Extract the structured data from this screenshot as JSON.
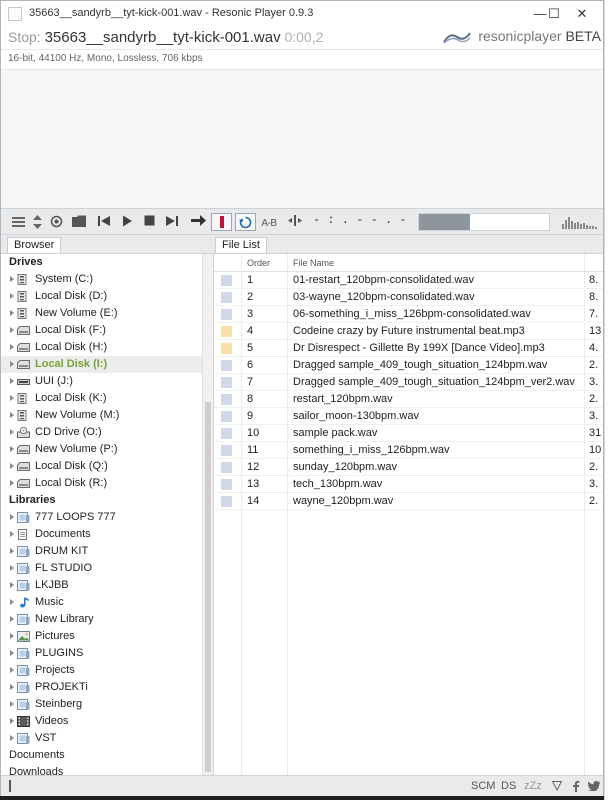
{
  "window": {
    "title": "35663__sandyrb__tyt-kick-001.wav - Resonic Player 0.9.3",
    "minimize": "—",
    "maximize": "☐",
    "close": "✕"
  },
  "player": {
    "status": "Stop:",
    "filename": "35663__sandyrb__tyt-kick-001.wav",
    "time": "0:00,2",
    "brand": "resonicplayer",
    "beta": "BETA",
    "fileinfo": "16-bit, 44100 Hz, Mono, Lossless, 706 kbps"
  },
  "toolbar": {
    "ab_label": "A-B",
    "position_readout": "- : . - - . -",
    "icons": [
      "menu-icon",
      "up-down-icon",
      "target-icon",
      "folder-icon",
      "skip-back-icon",
      "play-icon",
      "stop-icon",
      "skip-forward-icon",
      "arrow-right-icon",
      "record-marker-icon",
      "loop-icon",
      "ab-loop-icon",
      "split-icon",
      "spectrum-icon"
    ]
  },
  "browser": {
    "tab": "Browser",
    "drives_header": "Drives",
    "drives": [
      {
        "label": "System (C:)",
        "icon": "hdd-icon"
      },
      {
        "label": "Local Disk (D:)",
        "icon": "hdd-icon"
      },
      {
        "label": "New Volume (E:)",
        "icon": "hdd-icon"
      },
      {
        "label": "Local Disk (F:)",
        "icon": "usb-drive-icon"
      },
      {
        "label": "Local Disk (H:)",
        "icon": "usb-drive-icon"
      },
      {
        "label": "Local Disk (I:)",
        "icon": "usb-drive-icon",
        "selected": true
      },
      {
        "label": "UUI (J:)",
        "icon": "drive-icon"
      },
      {
        "label": "Local Disk (K:)",
        "icon": "hdd-icon"
      },
      {
        "label": "New Volume (M:)",
        "icon": "hdd-icon"
      },
      {
        "label": "CD Drive (O:)",
        "icon": "cd-drive-icon"
      },
      {
        "label": "New Volume (P:)",
        "icon": "usb-drive-icon"
      },
      {
        "label": "Local Disk (Q:)",
        "icon": "usb-drive-icon"
      },
      {
        "label": "Local Disk (R:)",
        "icon": "usb-drive-icon"
      }
    ],
    "libraries_header": "Libraries",
    "libraries": [
      {
        "label": "777 LOOPS 777",
        "icon": "library-icon"
      },
      {
        "label": "Documents",
        "icon": "documents-icon"
      },
      {
        "label": "DRUM KIT",
        "icon": "library-icon"
      },
      {
        "label": "FL STUDIO",
        "icon": "library-icon"
      },
      {
        "label": "LKJBB",
        "icon": "library-icon"
      },
      {
        "label": "Music",
        "icon": "music-note-icon"
      },
      {
        "label": "New Library",
        "icon": "library-icon"
      },
      {
        "label": "Pictures",
        "icon": "pictures-icon"
      },
      {
        "label": "PLUGINS",
        "icon": "library-icon"
      },
      {
        "label": "Projects",
        "icon": "library-icon"
      },
      {
        "label": "PROJEKTi",
        "icon": "library-icon"
      },
      {
        "label": "Steinberg",
        "icon": "library-icon"
      },
      {
        "label": "Videos",
        "icon": "videos-icon"
      },
      {
        "label": "VST",
        "icon": "library-icon"
      }
    ],
    "extra": [
      "Documents",
      "Downloads"
    ]
  },
  "filelist": {
    "tab": "File List",
    "col_order": "Order",
    "col_filename": "File Name",
    "rows": [
      {
        "order": "1",
        "name": "01-restart_120bpm-consolidated.wav",
        "extra": "8.",
        "color": "blue"
      },
      {
        "order": "2",
        "name": "03-wayne_120bpm-consolidated.wav",
        "extra": "8.",
        "color": "blue"
      },
      {
        "order": "3",
        "name": "06-something_i_miss_126bpm-consolidated.wav",
        "extra": "7.",
        "color": "blue"
      },
      {
        "order": "4",
        "name": "Codeine crazy by Future instrumental beat.mp3",
        "extra": "13",
        "color": "orange"
      },
      {
        "order": "5",
        "name": "Dr Disrespect - Gillette By 199X [Dance Video].mp3",
        "extra": "4.",
        "color": "orange"
      },
      {
        "order": "6",
        "name": "Dragged sample_409_tough_situation_124bpm.wav",
        "extra": "2.",
        "color": "blue"
      },
      {
        "order": "7",
        "name": "Dragged sample_409_tough_situation_124bpm_ver2.wav",
        "extra": "3.",
        "color": "blue"
      },
      {
        "order": "8",
        "name": "restart_120bpm.wav",
        "extra": "2.",
        "color": "blue"
      },
      {
        "order": "9",
        "name": "sailor_moon-130bpm.wav",
        "extra": "3.",
        "color": "blue"
      },
      {
        "order": "10",
        "name": "sample pack.wav",
        "extra": "31",
        "color": "blue"
      },
      {
        "order": "11",
        "name": "something_i_miss_126bpm.wav",
        "extra": "10",
        "color": "blue"
      },
      {
        "order": "12",
        "name": "sunday_120bpm.wav",
        "extra": "2.",
        "color": "blue"
      },
      {
        "order": "13",
        "name": "tech_130bpm.wav",
        "extra": "3.",
        "color": "blue"
      },
      {
        "order": "14",
        "name": "wayne_120bpm.wav",
        "extra": "2.",
        "color": "blue"
      }
    ]
  },
  "statusbar": {
    "scm": "SCM",
    "ds": "DS",
    "zzz": "zZz"
  },
  "colors": {
    "accent_selected": "#7aa336",
    "chip_blue": "#cfd9e8",
    "chip_orange": "#f8e1a8",
    "record_red": "#c0143c"
  }
}
